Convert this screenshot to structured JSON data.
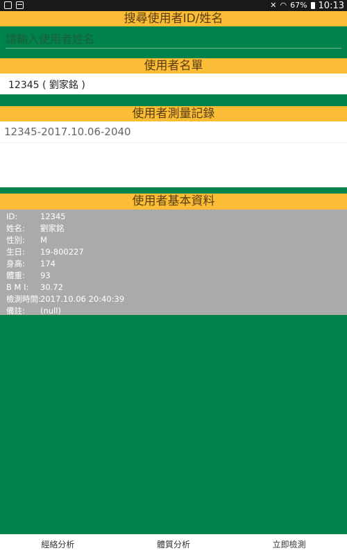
{
  "statusbar": {
    "battery": "67%",
    "time": "10:13",
    "icons": [
      "notification-icon",
      "photo-icon",
      "mute-icon",
      "wifi-icon",
      "battery-icon"
    ]
  },
  "search": {
    "header": "搜尋使用者ID/姓名",
    "placeholder": "請輸入使用者姓名",
    "value": ""
  },
  "users": {
    "header": "使用者名單",
    "items": [
      {
        "label": "12345 ( 劉家銘 )"
      }
    ]
  },
  "records": {
    "header": "使用者測量記錄",
    "items": [
      {
        "label": "12345-2017.10.06-2040"
      }
    ]
  },
  "basic_info": {
    "header": "使用者基本資料",
    "rows": [
      {
        "label": "ID:",
        "value": "12345"
      },
      {
        "label": "姓名:",
        "value": "劉家銘"
      },
      {
        "label": "性別:",
        "value": "M"
      },
      {
        "label": "生日:",
        "value": "19-800227"
      },
      {
        "label": "身高:",
        "value": "174"
      },
      {
        "label": "體重:",
        "value": "93"
      },
      {
        "label": "B M I:",
        "value": "30.72"
      },
      {
        "label": "檢測時間:",
        "value": "2017.10.06 20:40:39"
      },
      {
        "label": "備註:",
        "value": "(null)"
      }
    ]
  },
  "bottom_nav": {
    "items": [
      {
        "label": "經絡分析"
      },
      {
        "label": "體質分析"
      },
      {
        "label": "立即檢測"
      }
    ]
  },
  "colors": {
    "background_green": "#00834a",
    "header_yellow": "#fbbd35",
    "info_gray": "#aaaaaa"
  }
}
